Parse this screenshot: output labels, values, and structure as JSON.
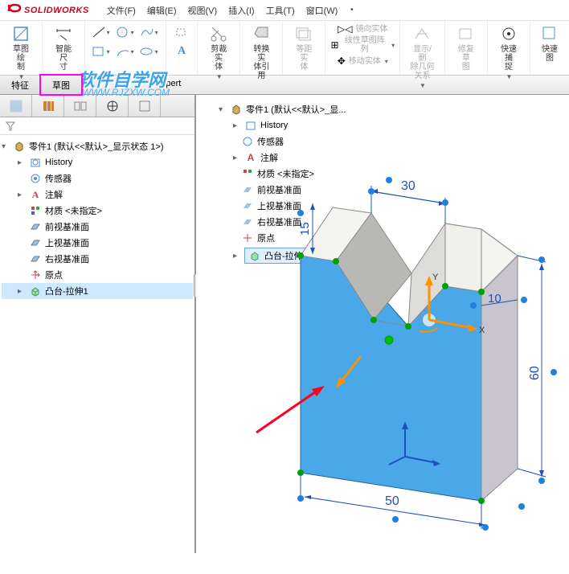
{
  "app": {
    "name": "SOLIDWORKS"
  },
  "menu": {
    "file": "文件(F)",
    "edit": "编辑(E)",
    "view": "视图(V)",
    "insert": "插入(I)",
    "tools": "工具(T)",
    "window": "窗口(W)"
  },
  "ribbon": {
    "sketch_draw": "草图绘\n制",
    "smart_dim": "智能尺\n寸",
    "trim": "剪裁实\n体",
    "convert": "转换实\n体引用",
    "mirror": "镜向实体",
    "linear_pattern": "线性草图阵列",
    "move": "移动实体",
    "offset": "等距实\n体",
    "show_hide": "显示/删\n除几何\n关系",
    "repair": "修复草\n图",
    "quick_snap": "快速捕\n捉",
    "quick_sketch": "快速\n图"
  },
  "tabs": {
    "feature": "特征",
    "sketch": "草图",
    "xpert": "Xpert"
  },
  "watermark": {
    "text": "软件自学网",
    "url": "WWW.RJZXW.COM"
  },
  "tree": {
    "root": "零件1 (默认<<默认>_显示状态 1>)",
    "history": "History",
    "sensors": "传感器",
    "annotations": "注解",
    "material": "材质 <未指定>",
    "front_plane": "前视基准面",
    "top_plane": "上视基准面",
    "right_plane": "右视基准面",
    "origin": "原点",
    "boss_extrude": "凸台-拉伸1"
  },
  "float_tree": {
    "root": "零件1 (默认<<默认>_显...",
    "boss_extrude": "凸台-拉伸1"
  },
  "chart_data": {
    "type": "3d_part",
    "dimensions": {
      "width": 50,
      "height": 60,
      "depth_visible": 10,
      "notch_top_width": 30,
      "notch_side": 15
    },
    "axes": [
      "X",
      "Y"
    ]
  }
}
